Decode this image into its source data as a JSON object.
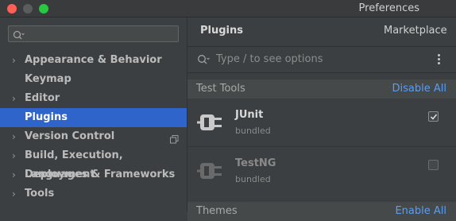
{
  "window": {
    "title": "Preferences"
  },
  "sidebar": {
    "search": {
      "placeholder": "",
      "value": ""
    },
    "items": [
      {
        "label": "Appearance & Behavior",
        "expandable": true
      },
      {
        "label": "Keymap",
        "expandable": false
      },
      {
        "label": "Editor",
        "expandable": true
      },
      {
        "label": "Plugins",
        "expandable": false,
        "selected": true
      },
      {
        "label": "Version Control",
        "expandable": true,
        "project_icon": "copy-icon"
      },
      {
        "label": "Build, Execution, Deployment",
        "expandable": true
      },
      {
        "label": "Languages & Frameworks",
        "expandable": true
      },
      {
        "label": "Tools",
        "expandable": true
      }
    ]
  },
  "main": {
    "title": "Plugins",
    "tabs": [
      {
        "label": "Marketplace"
      }
    ],
    "search": {
      "placeholder": "Type / to see options",
      "value": ""
    },
    "sections": [
      {
        "title": "Test Tools",
        "action": "Disable All",
        "plugins": [
          {
            "name": "JUnit",
            "subtitle": "bundled",
            "enabled": true,
            "icon": "plug-icon"
          },
          {
            "name": "TestNG",
            "subtitle": "bundled",
            "enabled": false,
            "icon": "plug-icon"
          }
        ]
      },
      {
        "title": "Themes",
        "action": "Enable All"
      }
    ]
  },
  "colors": {
    "background": "#3c3f41",
    "selection": "#2f65ca",
    "link": "#589df6",
    "section_header": "#45494a"
  }
}
